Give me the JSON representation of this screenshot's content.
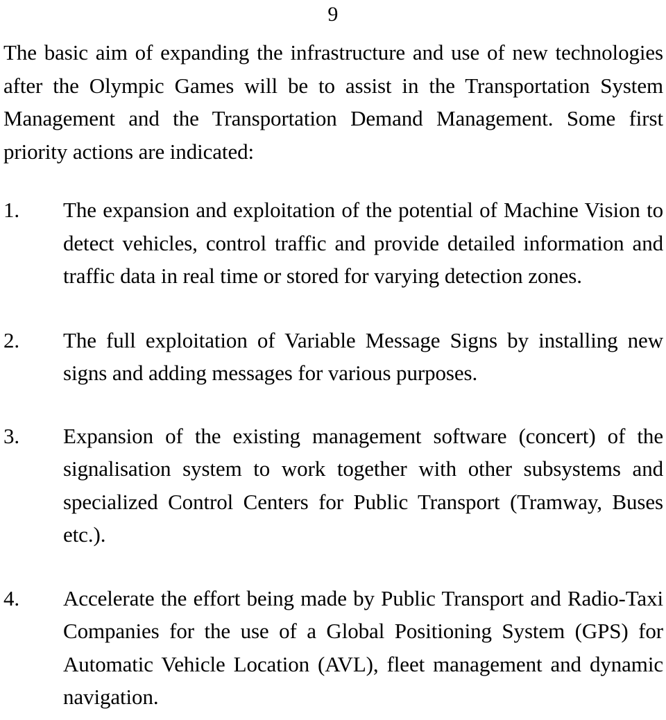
{
  "document": {
    "page_number": "9",
    "text_color": "#000000",
    "background_color": "#ffffff"
  },
  "intro_paragraph": {
    "text": "The basic aim of expanding the infrastructure and use of new technologies after the Olympic Games will be to assist in the Transportation System Management and the Transportation Demand Management. Some first priority actions are indicated:"
  },
  "list": {
    "items": [
      {
        "marker": "1.",
        "text": "The expansion and exploitation of the potential of Machine Vision to detect vehicles, control traffic and provide detailed information and traffic data in real time or stored for varying detection zones."
      },
      {
        "marker": "2.",
        "text": "The full exploitation of Variable Message Signs by installing new signs and adding messages for various purposes."
      },
      {
        "marker": "3.",
        "text": "Expansion of the existing management software (concert) of the signalisation system to work together with other subsystems and specialized Control Centers for Public Transport (Tramway, Buses etc.)."
      },
      {
        "marker": "4.",
        "text": "Accelerate the effort being made by Public Transport and Radio-Taxi Companies for the use of a Global Positioning System (GPS) for Automatic Vehicle Location (AVL), fleet management and dynamic navigation."
      }
    ]
  }
}
